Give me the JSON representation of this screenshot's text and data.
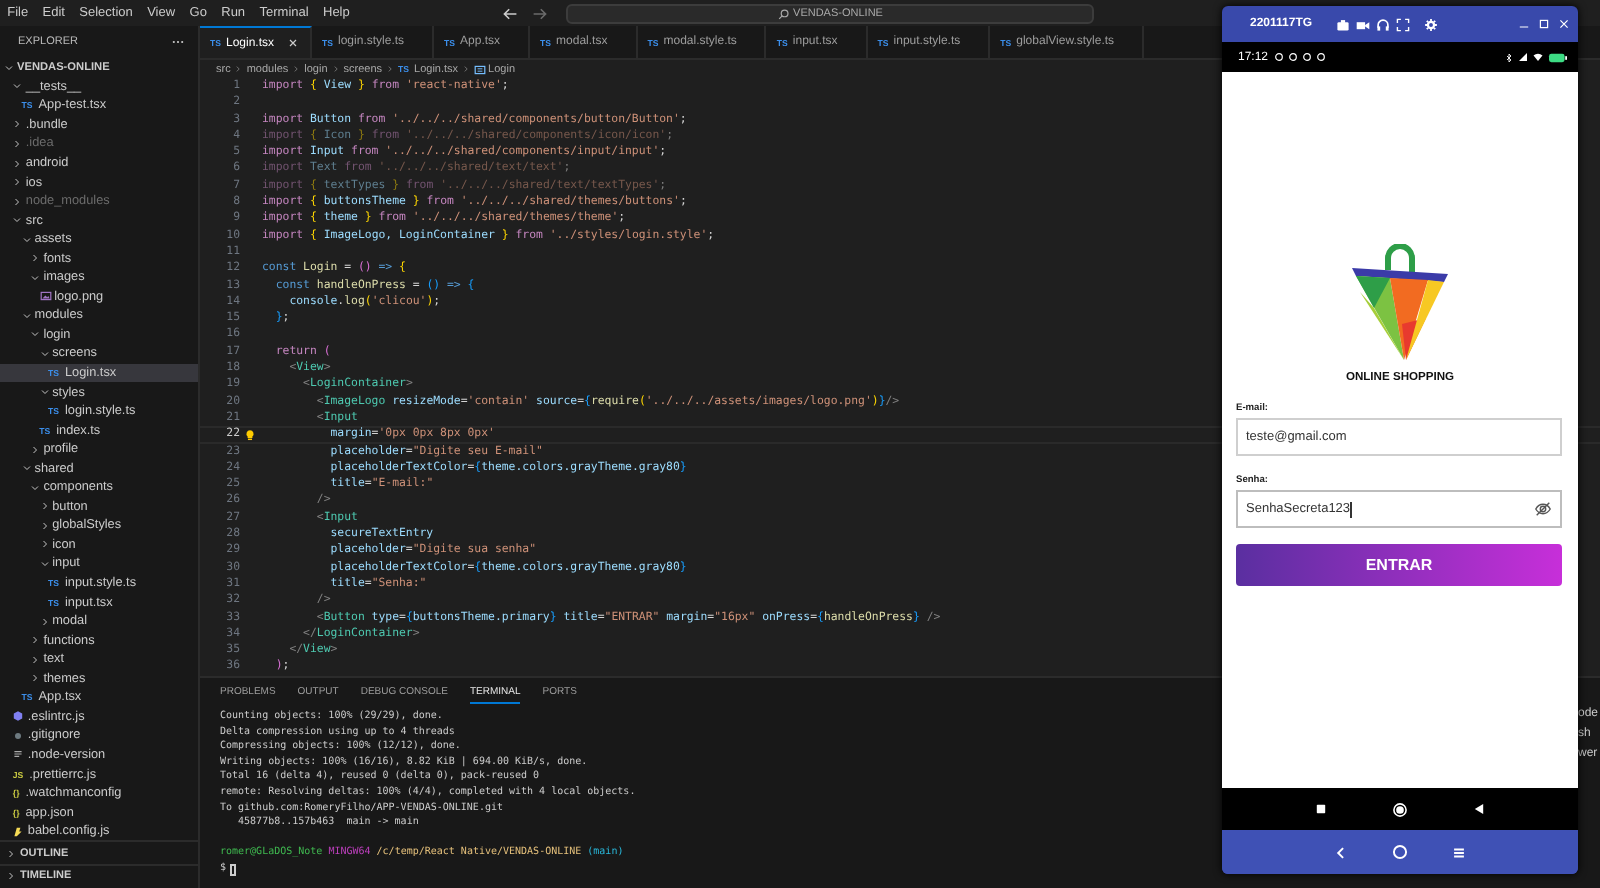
{
  "menu": [
    "File",
    "Edit",
    "Selection",
    "View",
    "Go",
    "Run",
    "Terminal",
    "Help"
  ],
  "search": {
    "label": "VENDAS-ONLINE"
  },
  "explorer": {
    "title": "EXPLORER",
    "tree": [
      {
        "label": "VENDAS-ONLINE",
        "kind": "folder",
        "expanded": true,
        "selected": false,
        "dimmed": false,
        "children": [
          {
            "label": "__tests__",
            "kind": "folder",
            "expanded": true,
            "selected": false,
            "dimmed": false,
            "children": [
              {
                "label": "App-test.tsx",
                "kind": "ts",
                "badge": "TS",
                "selected": false,
                "dimmed": false
              }
            ]
          },
          {
            "label": ".bundle",
            "kind": "folder",
            "expanded": false,
            "selected": false,
            "dimmed": false
          },
          {
            "label": ".idea",
            "kind": "folder",
            "expanded": false,
            "selected": false,
            "dimmed": true
          },
          {
            "label": "android",
            "kind": "folder",
            "expanded": false,
            "selected": false,
            "dimmed": false
          },
          {
            "label": "ios",
            "kind": "folder",
            "expanded": false,
            "selected": false,
            "dimmed": false
          },
          {
            "label": "node_modules",
            "kind": "folder",
            "expanded": false,
            "selected": false,
            "dimmed": true
          },
          {
            "label": "src",
            "kind": "folder",
            "expanded": true,
            "selected": false,
            "dimmed": false,
            "children": [
              {
                "label": "assets",
                "kind": "folder",
                "expanded": true,
                "selected": false,
                "dimmed": false,
                "children": [
                  {
                    "label": "fonts",
                    "kind": "folder",
                    "expanded": false,
                    "selected": false,
                    "dimmed": false
                  },
                  {
                    "label": "images",
                    "kind": "folder",
                    "expanded": true,
                    "selected": false,
                    "dimmed": false,
                    "children": [
                      {
                        "label": "logo.png",
                        "kind": "image",
                        "selected": false,
                        "dimmed": false
                      }
                    ]
                  }
                ]
              },
              {
                "label": "modules",
                "kind": "folder",
                "expanded": true,
                "selected": false,
                "dimmed": false,
                "children": [
                  {
                    "label": "login",
                    "kind": "folder",
                    "expanded": true,
                    "selected": false,
                    "dimmed": false,
                    "children": [
                      {
                        "label": "screens",
                        "kind": "folder",
                        "expanded": true,
                        "selected": false,
                        "dimmed": false,
                        "children": [
                          {
                            "label": "Login.tsx",
                            "kind": "ts",
                            "badge": "TS",
                            "selected": true,
                            "dimmed": false
                          }
                        ]
                      },
                      {
                        "label": "styles",
                        "kind": "folder",
                        "expanded": true,
                        "selected": false,
                        "dimmed": false,
                        "children": [
                          {
                            "label": "login.style.ts",
                            "kind": "ts",
                            "badge": "TS",
                            "selected": false,
                            "dimmed": false
                          }
                        ]
                      },
                      {
                        "label": "index.ts",
                        "kind": "ts",
                        "badge": "TS",
                        "selected": false,
                        "dimmed": false
                      }
                    ]
                  },
                  {
                    "label": "profile",
                    "kind": "folder",
                    "expanded": false,
                    "selected": false,
                    "dimmed": false
                  }
                ]
              },
              {
                "label": "shared",
                "kind": "folder",
                "expanded": true,
                "selected": false,
                "dimmed": false,
                "children": [
                  {
                    "label": "components",
                    "kind": "folder",
                    "expanded": true,
                    "selected": false,
                    "dimmed": false,
                    "children": [
                      {
                        "label": "button",
                        "kind": "folder",
                        "expanded": false,
                        "selected": false,
                        "dimmed": false
                      },
                      {
                        "label": "globalStyles",
                        "kind": "folder",
                        "expanded": false,
                        "selected": false,
                        "dimmed": false
                      },
                      {
                        "label": "icon",
                        "kind": "folder",
                        "expanded": false,
                        "selected": false,
                        "dimmed": false
                      },
                      {
                        "label": "input",
                        "kind": "folder",
                        "expanded": true,
                        "selected": false,
                        "dimmed": false,
                        "children": [
                          {
                            "label": "input.style.ts",
                            "kind": "ts",
                            "badge": "TS",
                            "selected": false,
                            "dimmed": false
                          },
                          {
                            "label": "input.tsx",
                            "kind": "ts",
                            "badge": "TS",
                            "selected": false,
                            "dimmed": false
                          }
                        ]
                      },
                      {
                        "label": "modal",
                        "kind": "folder",
                        "expanded": false,
                        "selected": false,
                        "dimmed": false
                      }
                    ]
                  },
                  {
                    "label": "functions",
                    "kind": "folder",
                    "expanded": false,
                    "selected": false,
                    "dimmed": false
                  },
                  {
                    "label": "text",
                    "kind": "folder",
                    "expanded": false,
                    "selected": false,
                    "dimmed": false
                  },
                  {
                    "label": "themes",
                    "kind": "folder",
                    "expanded": false,
                    "selected": false,
                    "dimmed": false
                  }
                ]
              },
              {
                "label": "App.tsx",
                "kind": "ts",
                "badge": "TS",
                "selected": false,
                "dimmed": false
              }
            ]
          },
          {
            "label": ".eslintrc.js",
            "kind": "eslint",
            "selected": false,
            "dimmed": false
          },
          {
            "label": ".gitignore",
            "kind": "git",
            "selected": false,
            "dimmed": false
          },
          {
            "label": ".node-version",
            "kind": "lines",
            "selected": false,
            "dimmed": false
          },
          {
            "label": ".prettierrc.js",
            "kind": "js",
            "badge": "JS",
            "selected": false,
            "dimmed": false
          },
          {
            "label": ".watchmanconfig",
            "kind": "json",
            "badge": "{}",
            "selected": false,
            "dimmed": false
          },
          {
            "label": "app.json",
            "kind": "json",
            "badge": "{}",
            "selected": false,
            "dimmed": false
          },
          {
            "label": "babel.config.js",
            "kind": "babel",
            "selected": false,
            "dimmed": false
          }
        ]
      }
    ],
    "sections": [
      {
        "label": "OUTLINE",
        "expanded": false
      },
      {
        "label": "TIMELINE",
        "expanded": false
      }
    ]
  },
  "tabs": [
    {
      "label": "Login.tsx",
      "badge": "TS",
      "selected": true
    },
    {
      "label": "login.style.ts",
      "badge": "TS",
      "selected": false
    },
    {
      "label": "App.tsx",
      "badge": "TS",
      "selected": false
    },
    {
      "label": "modal.tsx",
      "badge": "TS",
      "selected": false
    },
    {
      "label": "modal.style.ts",
      "badge": "TS",
      "selected": false
    },
    {
      "label": "input.tsx",
      "badge": "TS",
      "selected": false
    },
    {
      "label": "input.style.ts",
      "badge": "TS",
      "selected": false
    },
    {
      "label": "globalView.style.ts",
      "badge": "TS",
      "selected": false
    }
  ],
  "breadcrumb": [
    {
      "label": "src",
      "kind": "folder"
    },
    {
      "label": "modules",
      "kind": "folder"
    },
    {
      "label": "login",
      "kind": "folder"
    },
    {
      "label": "screens",
      "kind": "folder"
    },
    {
      "label": "Login.tsx",
      "kind": "file",
      "badge": "TS"
    },
    {
      "label": "Login",
      "kind": "symbol"
    }
  ],
  "editor": {
    "lines": [
      {
        "number": "1",
        "faded": false,
        "current": false,
        "tokens": [
          {
            "kind": "ctl",
            "text": "import "
          },
          {
            "kind": "br1",
            "text": "{"
          },
          {
            "kind": "var",
            "text": " View "
          },
          {
            "kind": "br1",
            "text": "}"
          },
          {
            "kind": "ctl",
            "text": " from "
          },
          {
            "kind": "str",
            "text": "'react-native'"
          },
          {
            "kind": "pun",
            "text": ";"
          }
        ]
      },
      {
        "number": "2",
        "current": false
      },
      {
        "number": "3",
        "faded": false,
        "current": false,
        "tokens": [
          {
            "kind": "ctl",
            "text": "import "
          },
          {
            "kind": "var",
            "text": "Button"
          },
          {
            "kind": "ctl",
            "text": " from "
          },
          {
            "kind": "str",
            "text": "'../../../shared/components/button/Button'"
          },
          {
            "kind": "pun",
            "text": ";"
          }
        ]
      },
      {
        "number": "4",
        "faded": true,
        "current": false,
        "tokens": [
          {
            "kind": "ctl",
            "text": "import "
          },
          {
            "kind": "br1",
            "text": "{"
          },
          {
            "kind": "var",
            "text": " Icon "
          },
          {
            "kind": "br1",
            "text": "}"
          },
          {
            "kind": "ctl",
            "text": " from "
          },
          {
            "kind": "str",
            "text": "'../../../shared/components/icon/icon'"
          },
          {
            "kind": "pun",
            "text": ";"
          }
        ]
      },
      {
        "number": "5",
        "faded": false,
        "current": false,
        "tokens": [
          {
            "kind": "ctl",
            "text": "import "
          },
          {
            "kind": "var",
            "text": "Input"
          },
          {
            "kind": "ctl",
            "text": " from "
          },
          {
            "kind": "str",
            "text": "'../../../shared/components/input/input'"
          },
          {
            "kind": "pun",
            "text": ";"
          }
        ]
      },
      {
        "number": "6",
        "faded": true,
        "current": false,
        "tokens": [
          {
            "kind": "ctl",
            "text": "import "
          },
          {
            "kind": "var",
            "text": "Text"
          },
          {
            "kind": "ctl",
            "text": " from "
          },
          {
            "kind": "str",
            "text": "'../../../shared/text/text'"
          },
          {
            "kind": "pun",
            "text": ";"
          }
        ]
      },
      {
        "number": "7",
        "faded": true,
        "current": false,
        "tokens": [
          {
            "kind": "ctl",
            "text": "import "
          },
          {
            "kind": "br1",
            "text": "{"
          },
          {
            "kind": "var",
            "text": " textTypes "
          },
          {
            "kind": "br1",
            "text": "}"
          },
          {
            "kind": "ctl",
            "text": " from "
          },
          {
            "kind": "str",
            "text": "'../../../shared/text/textTypes'"
          },
          {
            "kind": "pun",
            "text": ";"
          }
        ]
      },
      {
        "number": "8",
        "faded": false,
        "current": false,
        "tokens": [
          {
            "kind": "ctl",
            "text": "import "
          },
          {
            "kind": "br1",
            "text": "{"
          },
          {
            "kind": "var",
            "text": " buttonsTheme "
          },
          {
            "kind": "br1",
            "text": "}"
          },
          {
            "kind": "ctl",
            "text": " from "
          },
          {
            "kind": "str",
            "text": "'../../../shared/themes/buttons'"
          },
          {
            "kind": "pun",
            "text": ";"
          }
        ]
      },
      {
        "number": "9",
        "faded": false,
        "current": false,
        "tokens": [
          {
            "kind": "ctl",
            "text": "import "
          },
          {
            "kind": "br1",
            "text": "{"
          },
          {
            "kind": "var",
            "text": " theme "
          },
          {
            "kind": "br1",
            "text": "}"
          },
          {
            "kind": "ctl",
            "text": " from "
          },
          {
            "kind": "str",
            "text": "'../../../shared/themes/theme'"
          },
          {
            "kind": "pun",
            "text": ";"
          }
        ]
      },
      {
        "number": "10",
        "faded": false,
        "current": false,
        "tokens": [
          {
            "kind": "ctl",
            "text": "import "
          },
          {
            "kind": "br1",
            "text": "{"
          },
          {
            "kind": "var",
            "text": " ImageLogo, LoginContainer "
          },
          {
            "kind": "br1",
            "text": "}"
          },
          {
            "kind": "ctl",
            "text": " from "
          },
          {
            "kind": "str",
            "text": "'../styles/login.style'"
          },
          {
            "kind": "pun",
            "text": ";"
          }
        ]
      },
      {
        "number": "11",
        "current": false
      },
      {
        "number": "12",
        "faded": false,
        "current": false,
        "tokens": [
          {
            "kind": "kw",
            "text": "const "
          },
          {
            "kind": "fn",
            "text": "Login"
          },
          {
            "kind": "pun",
            "text": " = "
          },
          {
            "kind": "br2",
            "text": "()"
          },
          {
            "kind": "kw",
            "text": " => "
          },
          {
            "kind": "br1",
            "text": "{"
          }
        ]
      },
      {
        "number": "13",
        "faded": false,
        "current": false,
        "tokens": [
          {
            "kind": "kw",
            "text": "  const "
          },
          {
            "kind": "fn",
            "text": "handleOnPress"
          },
          {
            "kind": "pun",
            "text": " = "
          },
          {
            "kind": "br3",
            "text": "()"
          },
          {
            "kind": "kw",
            "text": " => "
          },
          {
            "kind": "br3",
            "text": "{"
          }
        ]
      },
      {
        "number": "14",
        "faded": false,
        "current": false,
        "tokens": [
          {
            "kind": "var",
            "text": "    console"
          },
          {
            "kind": "pun",
            "text": "."
          },
          {
            "kind": "fn",
            "text": "log"
          },
          {
            "kind": "br1",
            "text": "("
          },
          {
            "kind": "str",
            "text": "'clicou'"
          },
          {
            "kind": "br1",
            "text": ")"
          },
          {
            "kind": "pun",
            "text": ";"
          }
        ]
      },
      {
        "number": "15",
        "faded": false,
        "current": false,
        "tokens": [
          {
            "kind": "br3",
            "text": "  }"
          },
          {
            "kind": "pun",
            "text": ";"
          }
        ]
      },
      {
        "number": "16",
        "current": false
      },
      {
        "number": "17",
        "faded": false,
        "current": false,
        "tokens": [
          {
            "kind": "ctl",
            "text": "  return "
          },
          {
            "kind": "br2",
            "text": "("
          }
        ]
      },
      {
        "number": "18",
        "faded": false,
        "current": false,
        "tokens": [
          {
            "kind": "ang",
            "text": "    <"
          },
          {
            "kind": "tag",
            "text": "View"
          },
          {
            "kind": "ang",
            "text": ">"
          }
        ]
      },
      {
        "number": "19",
        "faded": false,
        "current": false,
        "tokens": [
          {
            "kind": "ang",
            "text": "      <"
          },
          {
            "kind": "tag",
            "text": "LoginContainer"
          },
          {
            "kind": "ang",
            "text": ">"
          }
        ]
      },
      {
        "number": "20",
        "faded": false,
        "current": false,
        "tokens": [
          {
            "kind": "ang",
            "text": "        <"
          },
          {
            "kind": "tag",
            "text": "ImageLogo"
          },
          {
            "kind": "attr",
            "text": " resizeMode"
          },
          {
            "kind": "pun",
            "text": "="
          },
          {
            "kind": "str",
            "text": "'contain'"
          },
          {
            "kind": "attr",
            "text": " source"
          },
          {
            "kind": "pun",
            "text": "="
          },
          {
            "kind": "br3",
            "text": "{"
          },
          {
            "kind": "fn",
            "text": "require"
          },
          {
            "kind": "br1",
            "text": "("
          },
          {
            "kind": "str",
            "text": "'../../../assets/images/logo.png'"
          },
          {
            "kind": "br1",
            "text": ")"
          },
          {
            "kind": "br3",
            "text": "}"
          },
          {
            "kind": "ang",
            "text": "/>"
          }
        ]
      },
      {
        "number": "21",
        "faded": false,
        "current": false,
        "tokens": [
          {
            "kind": "ang",
            "text": "        <"
          },
          {
            "kind": "tag",
            "text": "Input"
          }
        ]
      },
      {
        "number": "22",
        "faded": false,
        "current": true,
        "tokens": [
          {
            "kind": "attr",
            "text": "          margin"
          },
          {
            "kind": "pun",
            "text": "="
          },
          {
            "kind": "str",
            "text": "'0px 0px 8px 0px'"
          }
        ]
      },
      {
        "number": "23",
        "faded": false,
        "current": false,
        "tokens": [
          {
            "kind": "attr",
            "text": "          placeholder"
          },
          {
            "kind": "pun",
            "text": "="
          },
          {
            "kind": "str",
            "text": "\"Digite seu E-mail\""
          }
        ]
      },
      {
        "number": "24",
        "faded": false,
        "current": false,
        "tokens": [
          {
            "kind": "attr",
            "text": "          placeholderTextColor"
          },
          {
            "kind": "pun",
            "text": "="
          },
          {
            "kind": "br3",
            "text": "{"
          },
          {
            "kind": "var",
            "text": "theme.colors.grayTheme.gray80"
          },
          {
            "kind": "br3",
            "text": "}"
          }
        ]
      },
      {
        "number": "25",
        "faded": false,
        "current": false,
        "tokens": [
          {
            "kind": "attr",
            "text": "          title"
          },
          {
            "kind": "pun",
            "text": "="
          },
          {
            "kind": "str",
            "text": "\"E-mail:\""
          }
        ]
      },
      {
        "number": "26",
        "faded": false,
        "current": false,
        "tokens": [
          {
            "kind": "ang",
            "text": "        />"
          }
        ]
      },
      {
        "number": "27",
        "faded": false,
        "current": false,
        "tokens": [
          {
            "kind": "ang",
            "text": "        <"
          },
          {
            "kind": "tag",
            "text": "Input"
          }
        ]
      },
      {
        "number": "28",
        "faded": false,
        "current": false,
        "tokens": [
          {
            "kind": "attr",
            "text": "          secureTextEntry"
          }
        ]
      },
      {
        "number": "29",
        "faded": false,
        "current": false,
        "tokens": [
          {
            "kind": "attr",
            "text": "          placeholder"
          },
          {
            "kind": "pun",
            "text": "="
          },
          {
            "kind": "str",
            "text": "\"Digite sua senha\""
          }
        ]
      },
      {
        "number": "30",
        "faded": false,
        "current": false,
        "tokens": [
          {
            "kind": "attr",
            "text": "          placeholderTextColor"
          },
          {
            "kind": "pun",
            "text": "="
          },
          {
            "kind": "br3",
            "text": "{"
          },
          {
            "kind": "var",
            "text": "theme.colors.grayTheme.gray80"
          },
          {
            "kind": "br3",
            "text": "}"
          }
        ]
      },
      {
        "number": "31",
        "faded": false,
        "current": false,
        "tokens": [
          {
            "kind": "attr",
            "text": "          title"
          },
          {
            "kind": "pun",
            "text": "="
          },
          {
            "kind": "str",
            "text": "\"Senha:\""
          }
        ]
      },
      {
        "number": "32",
        "faded": false,
        "current": false,
        "tokens": [
          {
            "kind": "ang",
            "text": "        />"
          }
        ]
      },
      {
        "number": "33",
        "faded": false,
        "current": false,
        "tokens": [
          {
            "kind": "ang",
            "text": "        <"
          },
          {
            "kind": "tag",
            "text": "Button"
          },
          {
            "kind": "attr",
            "text": " type"
          },
          {
            "kind": "pun",
            "text": "="
          },
          {
            "kind": "br3",
            "text": "{"
          },
          {
            "kind": "var",
            "text": "buttonsTheme.primary"
          },
          {
            "kind": "br3",
            "text": "}"
          },
          {
            "kind": "attr",
            "text": " title"
          },
          {
            "kind": "pun",
            "text": "="
          },
          {
            "kind": "str",
            "text": "\"ENTRAR\""
          },
          {
            "kind": "attr",
            "text": " margin"
          },
          {
            "kind": "pun",
            "text": "="
          },
          {
            "kind": "str",
            "text": "\"16px\""
          },
          {
            "kind": "attr",
            "text": " onPress"
          },
          {
            "kind": "pun",
            "text": "="
          },
          {
            "kind": "br3",
            "text": "{"
          },
          {
            "kind": "fn",
            "text": "handleOnPress"
          },
          {
            "kind": "br3",
            "text": "}"
          },
          {
            "kind": "ang",
            "text": " />"
          }
        ]
      },
      {
        "number": "34",
        "faded": false,
        "current": false,
        "tokens": [
          {
            "kind": "ang",
            "text": "      </"
          },
          {
            "kind": "tag",
            "text": "LoginContainer"
          },
          {
            "kind": "ang",
            "text": ">"
          }
        ]
      },
      {
        "number": "35",
        "faded": false,
        "current": false,
        "tokens": [
          {
            "kind": "ang",
            "text": "    </"
          },
          {
            "kind": "tag",
            "text": "View"
          },
          {
            "kind": "ang",
            "text": ">"
          }
        ]
      },
      {
        "number": "36",
        "faded": false,
        "current": false,
        "tokens": [
          {
            "kind": "br2",
            "text": "  )"
          },
          {
            "kind": "pun",
            "text": ";"
          }
        ]
      }
    ]
  },
  "panel": {
    "tabs": [
      {
        "label": "PROBLEMS",
        "selected": false
      },
      {
        "label": "OUTPUT",
        "selected": false
      },
      {
        "label": "DEBUG CONSOLE",
        "selected": false
      },
      {
        "label": "TERMINAL",
        "selected": true
      },
      {
        "label": "PORTS",
        "selected": false
      }
    ],
    "terminal": [
      {
        "kind": "output",
        "segments": [
          {
            "kind": "plain",
            "text": "Counting objects: 100% (29/29), done."
          }
        ]
      },
      {
        "kind": "output",
        "segments": [
          {
            "kind": "plain",
            "text": "Delta compression using up to 4 threads"
          }
        ]
      },
      {
        "kind": "output",
        "segments": [
          {
            "kind": "plain",
            "text": "Compressing objects: 100% (12/12), done."
          }
        ]
      },
      {
        "kind": "output",
        "segments": [
          {
            "kind": "plain",
            "text": "Writing objects: 100% (16/16), 8.82 KiB | 694.00 KiB/s, done."
          }
        ]
      },
      {
        "kind": "output",
        "segments": [
          {
            "kind": "plain",
            "text": "Total 16 (delta 4), reused 0 (delta 0), pack-reused 0"
          }
        ]
      },
      {
        "kind": "output",
        "segments": [
          {
            "kind": "plain",
            "text": "remote: Resolving deltas: 100% (4/4), completed with 4 local objects."
          }
        ]
      },
      {
        "kind": "output",
        "segments": [
          {
            "kind": "plain",
            "text": "To github.com:RomeryFilho/APP-VENDAS-ONLINE.git"
          }
        ]
      },
      {
        "kind": "output",
        "segments": [
          {
            "kind": "plain",
            "text": "   45877b8..157b463  main -> main"
          }
        ]
      },
      {
        "kind": "prompt",
        "segments": [
          {
            "kind": "user",
            "text": "romer@GLaDOS_Note"
          },
          {
            "kind": "host",
            "text": " MINGW64"
          },
          {
            "kind": "path",
            "text": " /c/temp/React Native/VENDAS-ONLINE"
          },
          {
            "kind": "branch",
            "text": " (main)"
          }
        ]
      },
      {
        "kind": "input",
        "segments": [
          {
            "kind": "plain",
            "text": "$"
          }
        ]
      }
    ],
    "side_list": [
      "ode",
      "sh",
      "wer"
    ]
  },
  "emulator": {
    "title": "2201117TG",
    "time": "17:12",
    "brand": "ONLINE SHOPPING",
    "fields": [
      {
        "label": "E-mail:",
        "value": "teste@gmail.com",
        "kind": "text",
        "focused": false
      },
      {
        "label": "Senha:",
        "value": "SenhaSecreta123",
        "kind": "password",
        "focused": true
      }
    ],
    "button": "ENTRAR"
  }
}
